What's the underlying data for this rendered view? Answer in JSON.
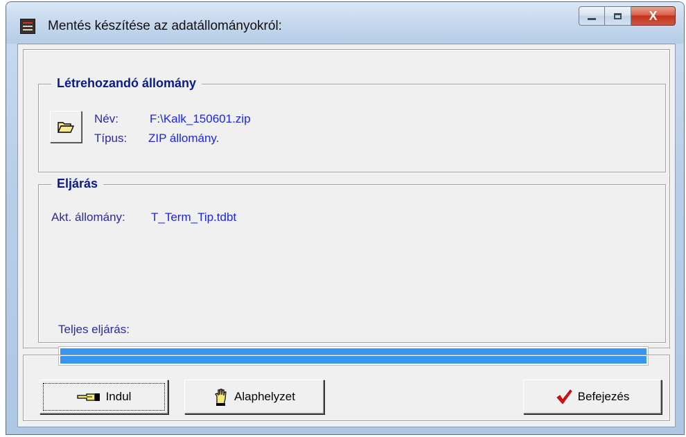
{
  "window": {
    "title": "Mentés készítése az adatállományokról:",
    "close_glyph": "X"
  },
  "output_group": {
    "legend": "Létrehozandó állomány",
    "name_label": "Név:",
    "name_value": "F:\\Kalk_150601.zip",
    "type_label": "Típus:",
    "type_value": "ZIP állomány."
  },
  "procedure_group": {
    "legend": "Eljárás",
    "current_file_label": "Akt. állomány:",
    "current_file_value": "T_Term_Tip.tdbt",
    "total_label": "Teljes eljárás:",
    "total_progress": 1.0,
    "progress_color": "#3797f0"
  },
  "buttons": {
    "start_label": "Indul",
    "reset_label": "Alaphelyzet",
    "finish_label": "Befejezés"
  },
  "icons": {
    "app": "app-icon",
    "folder": "folder-open-icon",
    "start": "pointing-hand-icon",
    "reset": "raised-hand-icon",
    "finish": "checkmark-icon"
  }
}
